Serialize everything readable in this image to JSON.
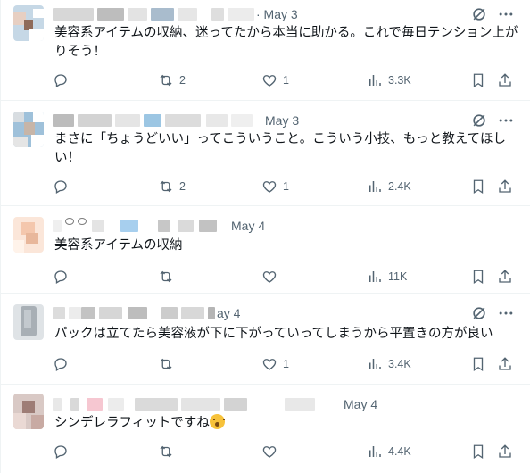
{
  "replies": [
    {
      "time": "· May 3",
      "text": "美容系アイテムの収納、迷ってたから本当に助かる。これで毎日テンション上がりそう！",
      "reply_count": "",
      "retweet_count": "2",
      "like_count": "1",
      "view_count": "3.3K"
    },
    {
      "time": "May 3",
      "text": "まさに「ちょうどいい」ってこういうこと。こういう小技、もっと教えてほしい！",
      "reply_count": "",
      "retweet_count": "2",
      "like_count": "1",
      "view_count": "2.4K"
    },
    {
      "time": "May 4",
      "text": "美容系アイテムの収納",
      "reply_count": "",
      "retweet_count": "",
      "like_count": "",
      "view_count": "11K"
    },
    {
      "time": "ay 4",
      "text": "パックは立てたら美容液が下に下がっていってしまうから平置きの方が良い",
      "reply_count": "",
      "retweet_count": "",
      "like_count": "1",
      "view_count": "3.4K"
    },
    {
      "time": "May 4",
      "text": "シンデレラフィットですね",
      "emoji": "hushed-face-emoji",
      "reply_count": "",
      "retweet_count": "",
      "like_count": "",
      "view_count": "4.4K"
    }
  ],
  "icons": {
    "reply": "reply-icon",
    "retweet": "retweet-icon",
    "like": "heart-icon",
    "views": "views-icon",
    "bookmark": "bookmark-icon",
    "share": "share-icon",
    "grok": "grok-icon",
    "more": "more-icon"
  },
  "colors": {
    "text": "#0f1419",
    "muted": "#536471",
    "divider": "#eff3f4"
  }
}
